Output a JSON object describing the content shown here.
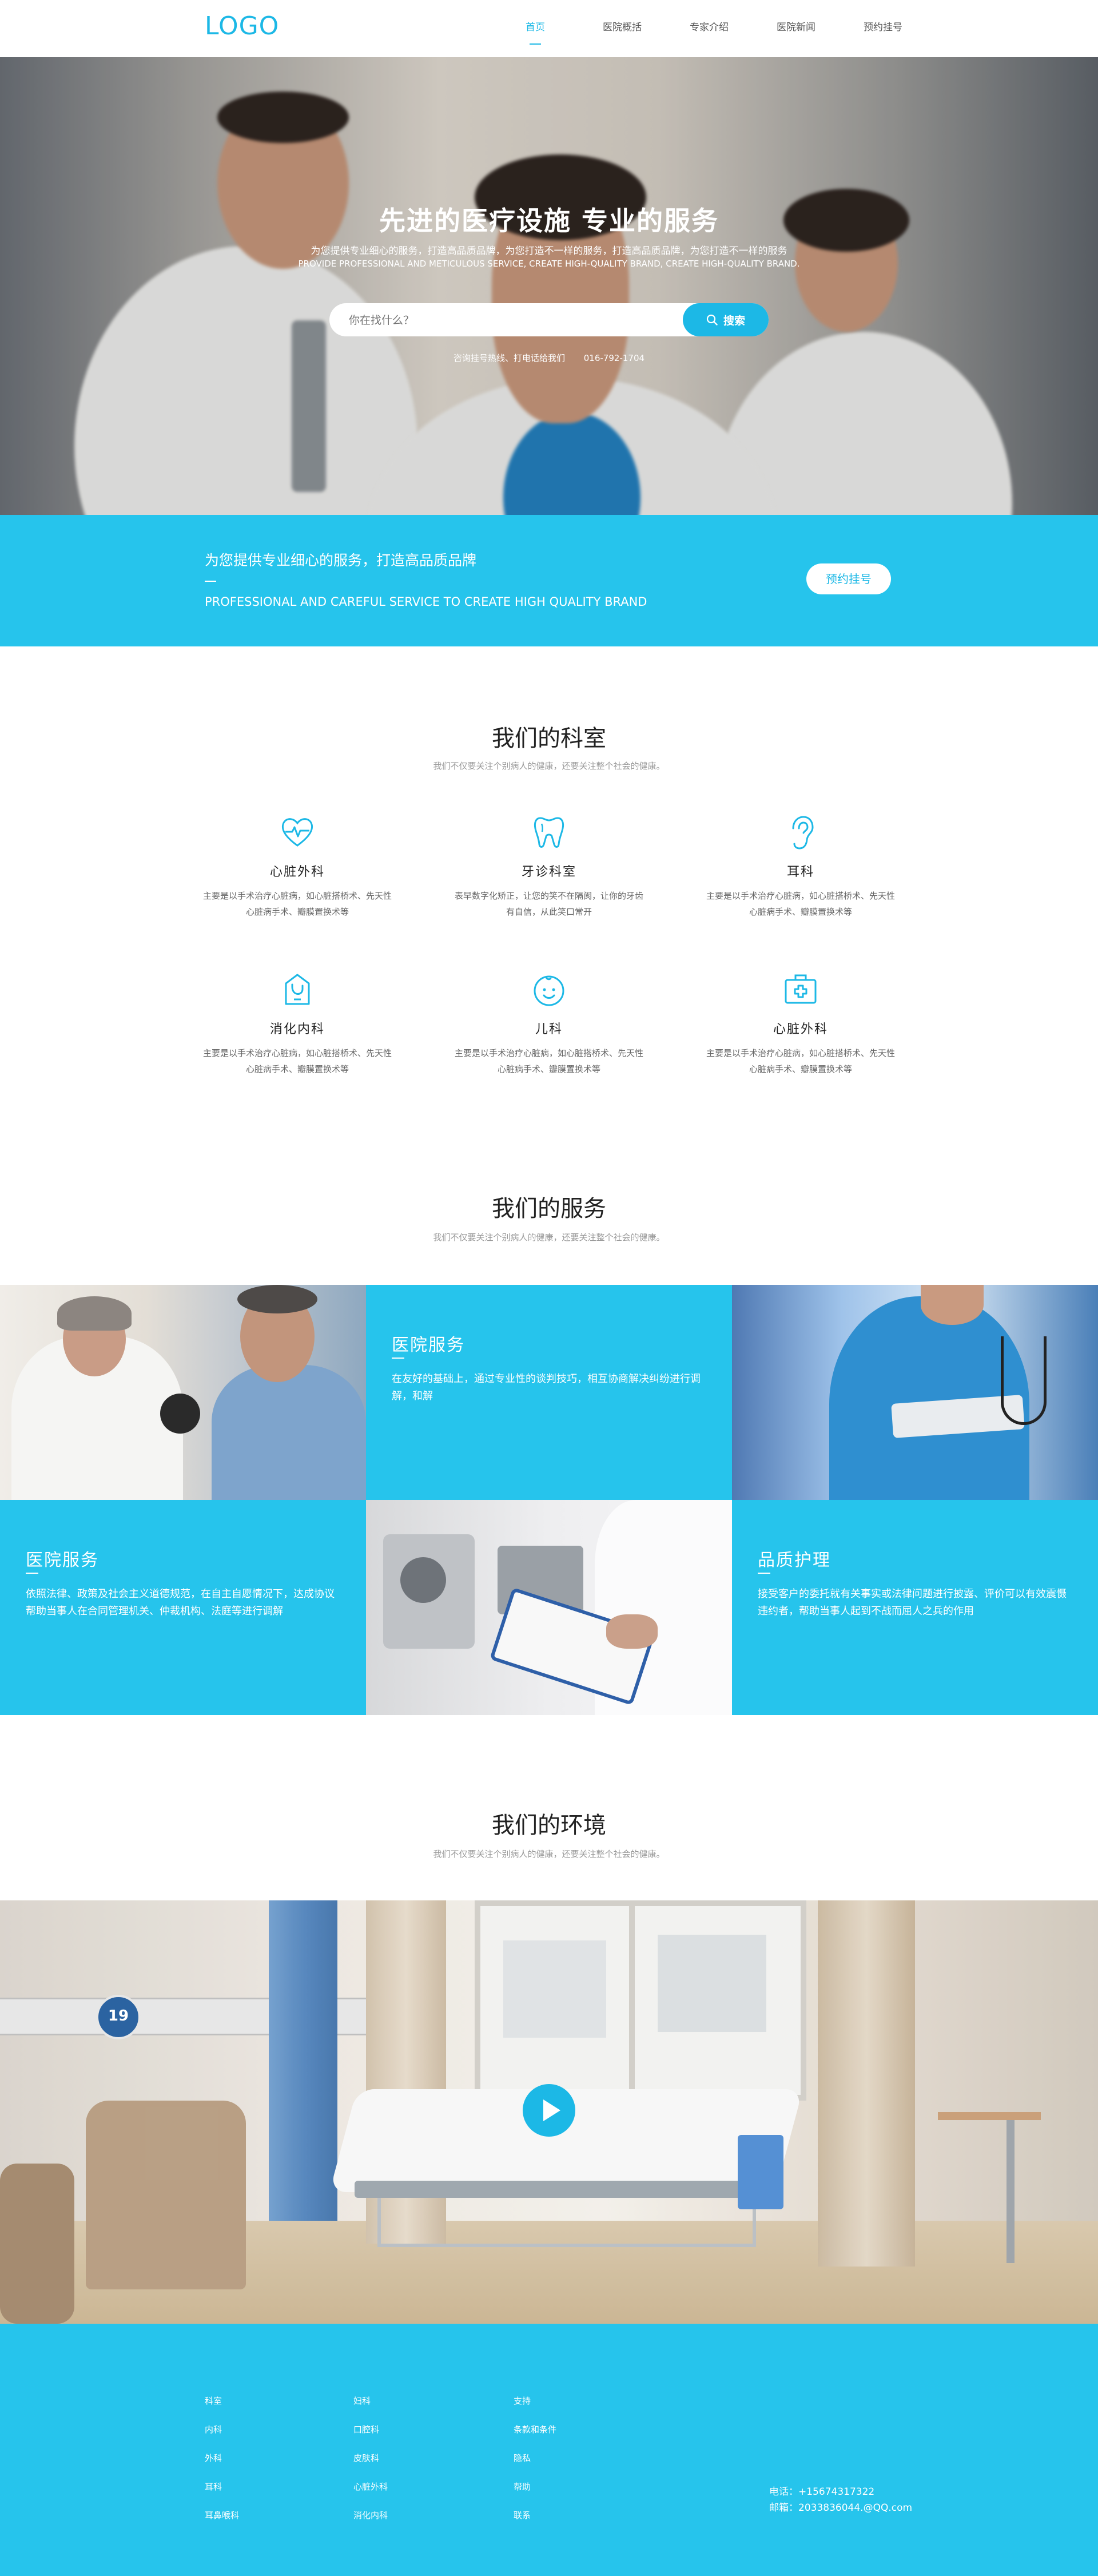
{
  "header": {
    "logo": "LOGO",
    "nav": [
      "首页",
      "医院概括",
      "专家介绍",
      "医院新闻",
      "预约挂号"
    ]
  },
  "hero": {
    "title": "先进的医疗设施 专业的服务",
    "subtitle_cn": "为您提供专业细心的服务，打造高品质品牌，为您打造不一样的服务，打造高品质品牌，为您打造不一样的服务",
    "subtitle_en": "PROVIDE PROFESSIONAL AND METICULOUS SERVICE, CREATE HIGH-QUALITY BRAND, CREATE HIGH-QUALITY BRAND.",
    "search_placeholder": "你在找什么？",
    "search_button": "搜索",
    "hotline_label": "咨询挂号热线、打电话给我们",
    "hotline_number": "016-792-1704",
    "icons": {
      "search": "search-icon"
    }
  },
  "banner": {
    "title": "为您提供专业细心的服务，打造高品质品牌",
    "subtitle": "PROFESSIONAL AND CAREFUL SERVICE TO CREATE HIGH QUALITY BRAND",
    "button": "预约挂号"
  },
  "departments": {
    "title": "我们的科室",
    "subtitle": "我们不仅要关注个别病人的健康，还要关注整个社会的健康。",
    "items": [
      {
        "name": "心脏外科",
        "icon": "heart-pulse-icon",
        "desc": "主要是以手术治疗心脏病，如心脏搭桥术、先天性心脏病手术、瓣膜置换术等"
      },
      {
        "name": "牙诊科室",
        "icon": "tooth-icon",
        "desc": "表早数字化矫正，让您的笑不在隔阂，让你的牙齿有自信，从此笑口常开"
      },
      {
        "name": "耳科",
        "icon": "ear-icon",
        "desc": "主要是以手术治疗心脏病，如心脏搭桥术、先天性心脏病手术、瓣膜置换术等"
      },
      {
        "name": "消化内科",
        "icon": "stomach-icon",
        "desc": "主要是以手术治疗心脏病，如心脏搭桥术、先天性心脏病手术、瓣膜置换术等"
      },
      {
        "name": "儿科",
        "icon": "baby-icon",
        "desc": "主要是以手术治疗心脏病，如心脏搭桥术、先天性心脏病手术、瓣膜置换术等"
      },
      {
        "name": "心脏外科",
        "icon": "medical-kit-icon",
        "desc": "主要是以手术治疗心脏病，如心脏搭桥术、先天性心脏病手术、瓣膜置换术等"
      }
    ]
  },
  "services": {
    "title": "我们的服务",
    "subtitle": "我们不仅要关注个别病人的健康，还要关注整个社会的健康。",
    "cards": [
      {
        "title": "医院服务",
        "desc": "在友好的基础上，通过专业性的谈判技巧，相互协商解决纠纷进行调解，和解"
      },
      {
        "title": "医院服务",
        "desc": "依照法律、政策及社会主义道德规范，在自主自愿情况下，达成协议帮助当事人在合同管理机关、仲裁机构、法庭等进行调解"
      },
      {
        "title": "品质护理",
        "desc": "接受客户的委托就有关事实或法律问题进行披露、评价可以有效震慑违约者，帮助当事人起到不战而屈人之兵的作用"
      }
    ]
  },
  "environment": {
    "title": "我们的环境",
    "subtitle": "我们不仅要关注个别病人的健康，还要关注整个社会的健康。",
    "room_number": "19",
    "icons": {
      "play": "play-icon"
    }
  },
  "footer": {
    "columns": [
      [
        "科室",
        "内科",
        "外科",
        "耳科",
        "耳鼻喉科"
      ],
      [
        "妇科",
        "口腔科",
        "皮肤科",
        "心脏外科",
        "消化内科"
      ],
      [
        "支持",
        "条款和条件",
        "隐私",
        "帮助",
        "联系"
      ]
    ],
    "phone": "电话：+15674317322",
    "email": "邮箱：2033836044.@QQ.com"
  },
  "colors": {
    "accent": "#1cb8e6",
    "banner": "#26c4ec"
  }
}
